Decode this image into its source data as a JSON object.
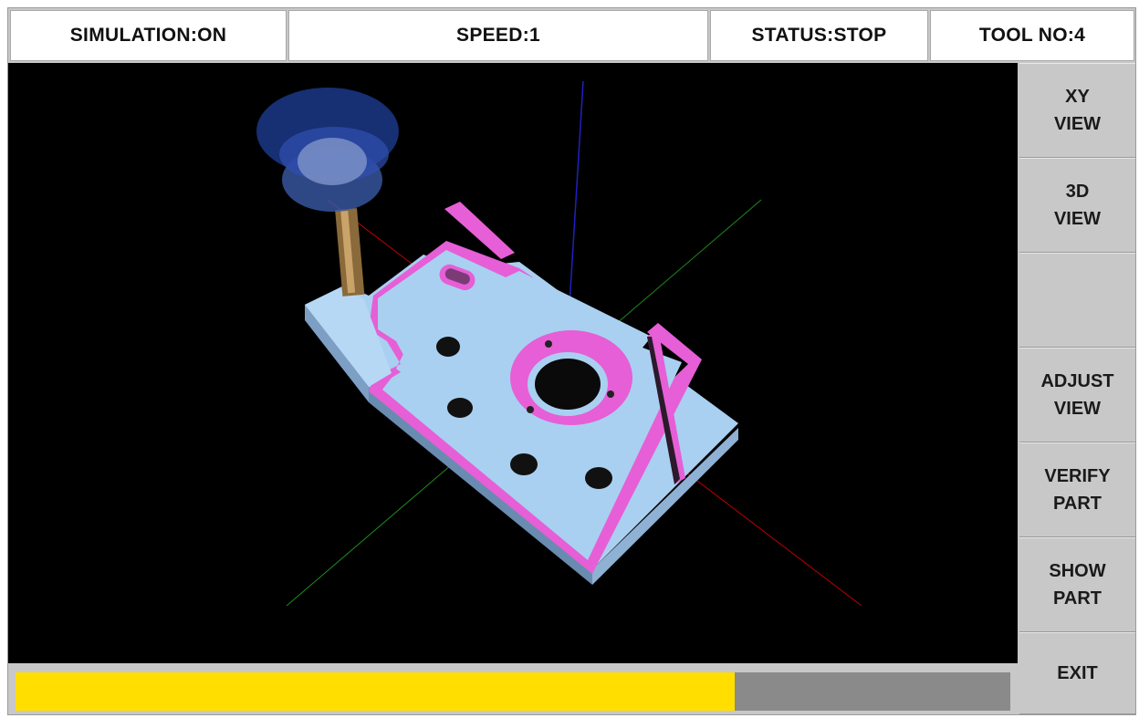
{
  "status_bar": {
    "simulation": "SIMULATION:ON",
    "speed": "SPEED:1",
    "status": "STATUS:STOP",
    "tool": "TOOL NO:4"
  },
  "side_buttons": {
    "xy_view": "XY\nVIEW",
    "view_3d": "3D\nVIEW",
    "blank": "",
    "adjust_view": "ADJUST\nVIEW",
    "verify_part": "VERIFY\nPART",
    "show_part": "SHOW\nPART",
    "exit": "EXIT"
  },
  "progress": {
    "fraction": 0.723,
    "fill_color": "#ffde00",
    "track_color": "#8a8a8a"
  },
  "colors": {
    "part_top": "#a9d0f0",
    "part_cut": "#e65fd6",
    "axis_x": "#c00000",
    "axis_y": "#1f8a1f",
    "axis_z": "#2020c0",
    "tool_holder": "#2a4fb8"
  }
}
